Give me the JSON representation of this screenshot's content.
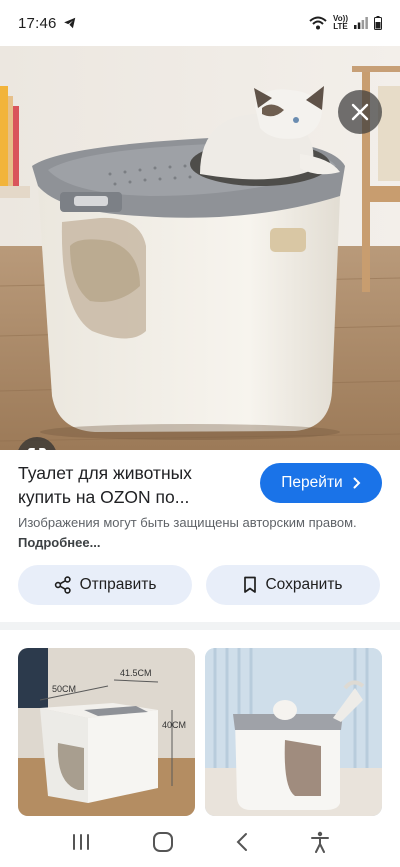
{
  "status_bar": {
    "time": "17:46",
    "network_top": "Vo))",
    "network_bottom": "LTE"
  },
  "viewer": {
    "close_label": "close",
    "lens_label": "google-lens"
  },
  "result": {
    "title": "Туалет для животных купить на OZON по...",
    "go_button": "Перейти",
    "copyright_text": "Изображения могут быть защищены авторским правом.",
    "more_link": "Подробнее..."
  },
  "actions": {
    "share_label": "Отправить",
    "save_label": "Сохранить"
  },
  "related": {
    "dim_width": "41.5CM",
    "dim_depth": "50CM",
    "dim_height": "40CM"
  },
  "colors": {
    "primary": "#1a73e8",
    "chip_bg": "#e8eef9",
    "muted_text": "#5f6368"
  },
  "icons": {
    "telegram": "paper-plane",
    "wifi": "wifi",
    "signal": "signal-bars",
    "battery": "battery",
    "close": "x-mark",
    "lens": "camera-lens",
    "share": "share-nodes",
    "save": "bookmark",
    "nav_recent": "three-bars",
    "nav_home": "rounded-square",
    "nav_back": "chevron-left",
    "nav_accessibility": "person"
  }
}
